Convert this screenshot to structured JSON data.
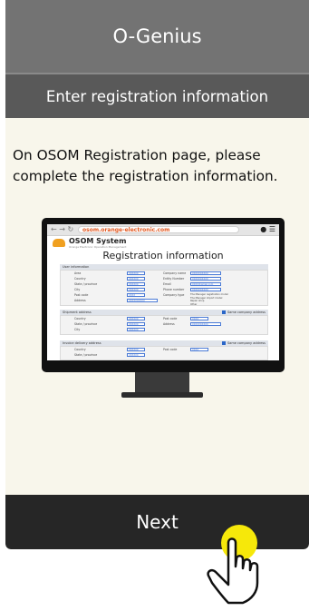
{
  "header": {
    "title": "O-Genius",
    "subtitle": "Enter registration information"
  },
  "instructions": "On OSOM Registration page, please complete the registration information.",
  "illustration": {
    "url": "osom.orange-electronic.com",
    "brand": "OSOM System",
    "brand_sub": "Orange Electronic Operation Management",
    "page_title": "Registration information",
    "sections": [
      {
        "title": "User information",
        "same_label": ""
      },
      {
        "title": "Shipment address",
        "same_label": "Same company address"
      },
      {
        "title": "Invoice delivery address",
        "same_label": "Same company address"
      }
    ],
    "user_rows": [
      {
        "label": "Area",
        "value": "XXXXXX",
        "label2": "Company name",
        "value2": "XXXXXXXXXX"
      },
      {
        "label": "Country",
        "value": "XXXXXX",
        "label2": "Entity Number",
        "value2": "XXXXXXXXXX"
      },
      {
        "label": "State / province",
        "value": "XXXXXX",
        "label2": "Email",
        "value2": "XXXX@gmail.com"
      },
      {
        "label": "City",
        "value": "XXXXXX",
        "label2": "Phone number",
        "value2": "XXXXXXXXXX"
      },
      {
        "label": "Post code",
        "value": "XXXX",
        "label2": "Company type",
        "value2": ""
      },
      {
        "label": "Address",
        "value": "XXXXXXXXXX",
        "label2": "",
        "value2": ""
      }
    ],
    "company_types": [
      "The Manager registration model",
      "The Manager import model",
      "Repair shop",
      "Other"
    ],
    "shipment_rows": [
      {
        "label": "Country",
        "value": "XXXXXX",
        "label2": "Post code",
        "value2": "XXXX"
      },
      {
        "label": "State / province",
        "value": "XXXXXX",
        "label2": "Address",
        "value2": "XXXXXXXXXX"
      },
      {
        "label": "City",
        "value": "XXXXXX",
        "label2": "",
        "value2": ""
      }
    ],
    "invoice_rows": [
      {
        "label": "Country",
        "value": "XXXXXX",
        "label2": "Post code",
        "value2": "XXXX"
      },
      {
        "label": "State / province",
        "value": "XXXXXX",
        "label2": "",
        "value2": ""
      }
    ]
  },
  "next_button": {
    "label": "Next"
  },
  "colors": {
    "title_bar": "#737373",
    "subtitle_bar": "#595959",
    "background": "#f8f6eb",
    "button": "#262626",
    "tap_indicator": "#f6e80a",
    "url_text": "#e2571f"
  }
}
